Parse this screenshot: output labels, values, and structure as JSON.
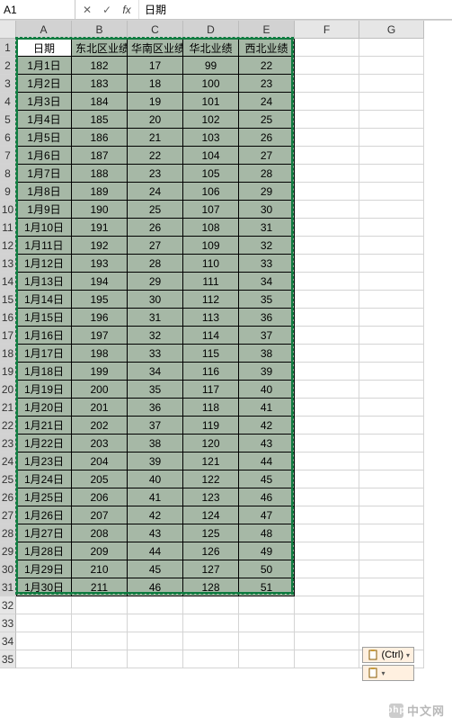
{
  "name_box": {
    "value": "A1"
  },
  "formula_bar": {
    "value": "日期"
  },
  "fx_buttons": {
    "cancel": "✕",
    "enter": "✓",
    "fx": "fx"
  },
  "columns": [
    "A",
    "B",
    "C",
    "D",
    "E",
    "F",
    "G"
  ],
  "selected_cols": [
    "A",
    "B",
    "C",
    "D",
    "E"
  ],
  "visible_row_start": 1,
  "visible_row_end": 35,
  "selected_rows": {
    "from": 1,
    "to": 31
  },
  "smart_tag": {
    "ctrl_label": "(Ctrl)",
    "paste_icon": "paste"
  },
  "watermark": {
    "text": "中文网",
    "logo": "php"
  },
  "chart_data": {
    "type": "table",
    "headers": [
      "日期",
      "东北区业绩",
      "华南区业绩",
      "华北业绩",
      "西北业绩"
    ],
    "rows": [
      [
        "1月1日",
        182,
        17,
        99,
        22
      ],
      [
        "1月2日",
        183,
        18,
        100,
        23
      ],
      [
        "1月3日",
        184,
        19,
        101,
        24
      ],
      [
        "1月4日",
        185,
        20,
        102,
        25
      ],
      [
        "1月5日",
        186,
        21,
        103,
        26
      ],
      [
        "1月6日",
        187,
        22,
        104,
        27
      ],
      [
        "1月7日",
        188,
        23,
        105,
        28
      ],
      [
        "1月8日",
        189,
        24,
        106,
        29
      ],
      [
        "1月9日",
        190,
        25,
        107,
        30
      ],
      [
        "1月10日",
        191,
        26,
        108,
        31
      ],
      [
        "1月11日",
        192,
        27,
        109,
        32
      ],
      [
        "1月12日",
        193,
        28,
        110,
        33
      ],
      [
        "1月13日",
        194,
        29,
        111,
        34
      ],
      [
        "1月14日",
        195,
        30,
        112,
        35
      ],
      [
        "1月15日",
        196,
        31,
        113,
        36
      ],
      [
        "1月16日",
        197,
        32,
        114,
        37
      ],
      [
        "1月17日",
        198,
        33,
        115,
        38
      ],
      [
        "1月18日",
        199,
        34,
        116,
        39
      ],
      [
        "1月19日",
        200,
        35,
        117,
        40
      ],
      [
        "1月20日",
        201,
        36,
        118,
        41
      ],
      [
        "1月21日",
        202,
        37,
        119,
        42
      ],
      [
        "1月22日",
        203,
        38,
        120,
        43
      ],
      [
        "1月23日",
        204,
        39,
        121,
        44
      ],
      [
        "1月24日",
        205,
        40,
        122,
        45
      ],
      [
        "1月25日",
        206,
        41,
        123,
        46
      ],
      [
        "1月26日",
        207,
        42,
        124,
        47
      ],
      [
        "1月27日",
        208,
        43,
        125,
        48
      ],
      [
        "1月28日",
        209,
        44,
        126,
        49
      ],
      [
        "1月29日",
        210,
        45,
        127,
        50
      ],
      [
        "1月30日",
        211,
        46,
        128,
        51
      ]
    ]
  }
}
